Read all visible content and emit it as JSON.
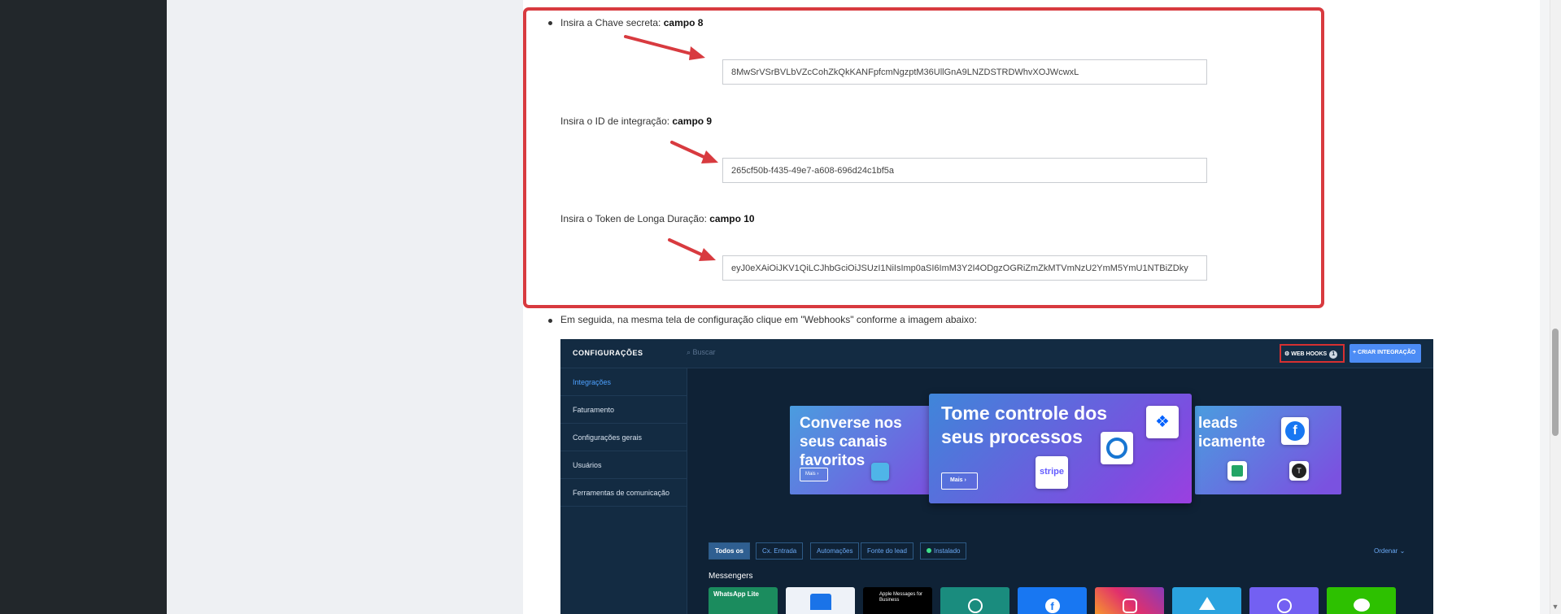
{
  "steps": {
    "chave_label": "Insira a Chave secreta: ",
    "chave_campo": "campo 8",
    "chave_value": "8MwSrVSrBVLbVZcCohZkQkKANFpfcmNgzptM36UllGnA9LNZDSTRDWhvXOJWcwxL",
    "id_label": "Insira o ID de integração: ",
    "id_campo": "campo 9",
    "id_value": "265cf50b-f435-49e7-a608-696d24c1bf5a",
    "token_label": "Insira o Token de Longa Duração: ",
    "token_campo": "campo 10",
    "token_value": "eyJ0eXAiOiJKV1QiLCJhbGciOiJSUzI1NiIsImp0aSI6ImM3Y2I4ODgzOGRiZmZkMTVmNzU2YmM5YmU1NTBiZDky",
    "next_instruction": "Em seguida, na mesma tela de configuração clique em \"Webhooks\" conforme a imagem abaixo:"
  },
  "screenshot": {
    "title": "CONFIGURAÇÕES",
    "search_placeholder": "Buscar",
    "webhooks_label": "WEB HOOKS",
    "webhooks_count": "1",
    "create_label": "+ CRIAR INTEGRAÇÃO",
    "sidebar": [
      "Integrações",
      "Faturamento",
      "Configurações gerais",
      "Usuários",
      "Ferramentas de comunicação"
    ],
    "banner_left": "Converse nos seus canais favoritos",
    "banner_left_more": "Mais ›",
    "banner_main": "Tome controle dos seus processos",
    "banner_main_more": "Mais ›",
    "banner_right": "leads icamente",
    "filters": [
      "Todos os",
      "Cx. Entrada",
      "Automações",
      "Fonte do lead",
      "Instalado"
    ],
    "order_label": "Ordenar ⌄",
    "messengers_label": "Messengers",
    "stripe_label": "stripe",
    "whatsapp_lite": "WhatsApp Lite",
    "apple_messages": "Apple Messages for Business"
  },
  "colors": {
    "highlight": "#d83a3f",
    "arrow": "#d83a3f",
    "accent_blue": "#4c8cf5"
  }
}
